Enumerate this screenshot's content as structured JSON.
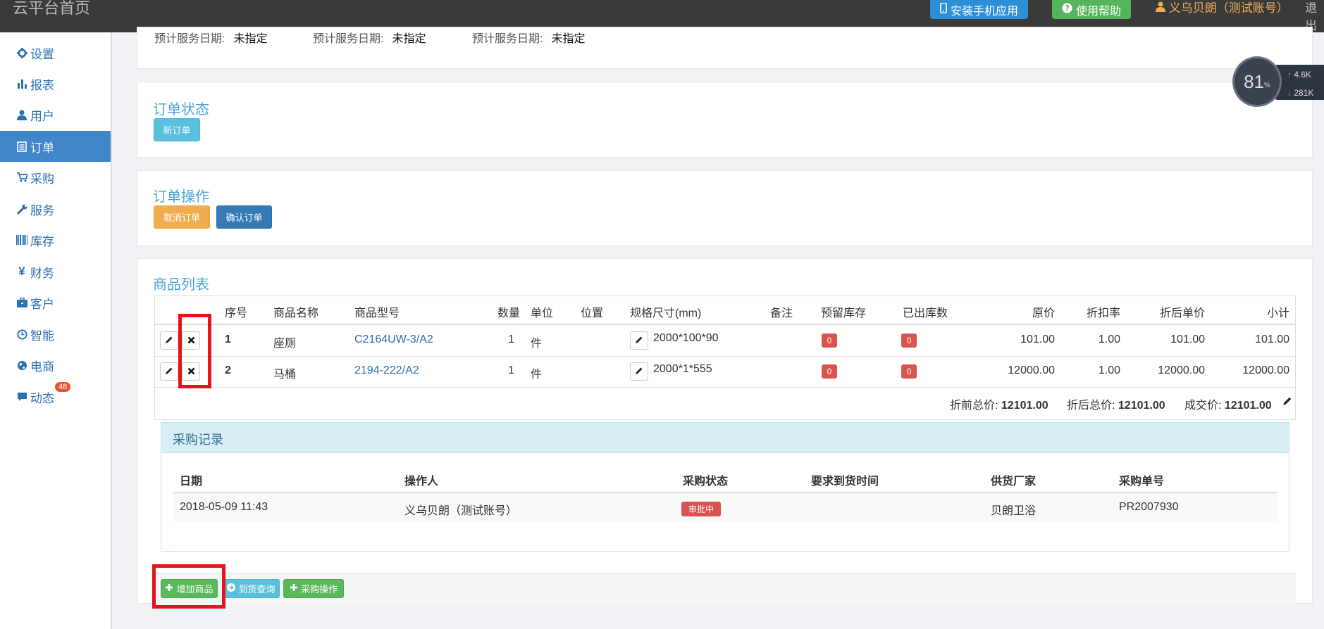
{
  "topbar": {
    "brand": "云平台首页",
    "install_app": "安装手机应用",
    "help": "使用帮助",
    "user": "义乌贝朗（测试账号）",
    "logout": "退出"
  },
  "sidebar": {
    "items": [
      {
        "label": "设置",
        "icon": "gear-icon"
      },
      {
        "label": "报表",
        "icon": "bar-chart-icon"
      },
      {
        "label": "用户",
        "icon": "user-icon"
      },
      {
        "label": "订单",
        "icon": "list-icon"
      },
      {
        "label": "采购",
        "icon": "cart-icon"
      },
      {
        "label": "服务",
        "icon": "wrench-icon"
      },
      {
        "label": "库存",
        "icon": "barcode-icon"
      },
      {
        "label": "财务",
        "icon": "yen-icon"
      },
      {
        "label": "客户",
        "icon": "briefcase-icon"
      },
      {
        "label": "智能",
        "icon": "clock-icon"
      },
      {
        "label": "电商",
        "icon": "globe-icon"
      },
      {
        "label": "动态",
        "icon": "comment-icon"
      }
    ],
    "active": "订单",
    "dynamic_badge": "48"
  },
  "service_dates": [
    {
      "label": "预计服务日期:",
      "value": "未指定"
    },
    {
      "label": "预计服务日期:",
      "value": "未指定"
    },
    {
      "label": "预计服务日期:",
      "value": "未指定"
    }
  ],
  "order_status": {
    "title": "订单状态",
    "button": "新订单"
  },
  "order_ops": {
    "title": "订单操作",
    "cancel": "取消订单",
    "confirm": "确认订单"
  },
  "products": {
    "title": "商品列表",
    "headers": {
      "seq": "序号",
      "name": "商品名称",
      "model": "商品型号",
      "qty": "数量",
      "unit": "单位",
      "location": "位置",
      "spec": "规格尺寸(mm)",
      "remark": "备注",
      "reserved": "预留库存",
      "shipped": "已出库数",
      "orig_price": "原价",
      "discount": "折扣率",
      "disc_price": "折后单价",
      "subtotal": "小计"
    },
    "rows": [
      {
        "seq": "1",
        "name": "座厕",
        "model": "C2164UW-3/A2",
        "qty": "1",
        "unit": "件",
        "spec": "2000*100*90",
        "reserved": "0",
        "shipped": "0",
        "orig_price": "101.00",
        "discount": "1.00",
        "disc_price": "101.00",
        "subtotal": "101.00"
      },
      {
        "seq": "2",
        "name": "马桶",
        "model": "2194-222/A2",
        "qty": "1",
        "unit": "件",
        "spec": "2000*1*555",
        "reserved": "0",
        "shipped": "0",
        "orig_price": "12000.00",
        "discount": "1.00",
        "disc_price": "12000.00",
        "subtotal": "12000.00"
      }
    ],
    "totals": {
      "before_label": "折前总价:",
      "before_value": "12101.00",
      "after_label": "折后总价:",
      "after_value": "12101.00",
      "deal_label": "成交价:",
      "deal_value": "12101.00"
    }
  },
  "purchase": {
    "title": "采购记录",
    "headers": {
      "date": "日期",
      "operator": "操作人",
      "status": "采购状态",
      "arrival": "要求到货时间",
      "supplier": "供货厂家",
      "po": "采购单号"
    },
    "row": {
      "date": "2018-05-09 11:43",
      "operator": "义乌贝朗（测试账号）",
      "status": "审批中",
      "arrival": "",
      "supplier": "贝朗卫浴",
      "po": "PR2007930"
    }
  },
  "footer_buttons": {
    "add": "增加商品",
    "arrival_query": "到货查询",
    "purchase_op": "采购操作"
  },
  "widget": {
    "percent": "81",
    "percent_unit": "%",
    "up": "4.6K",
    "down": "281K"
  }
}
